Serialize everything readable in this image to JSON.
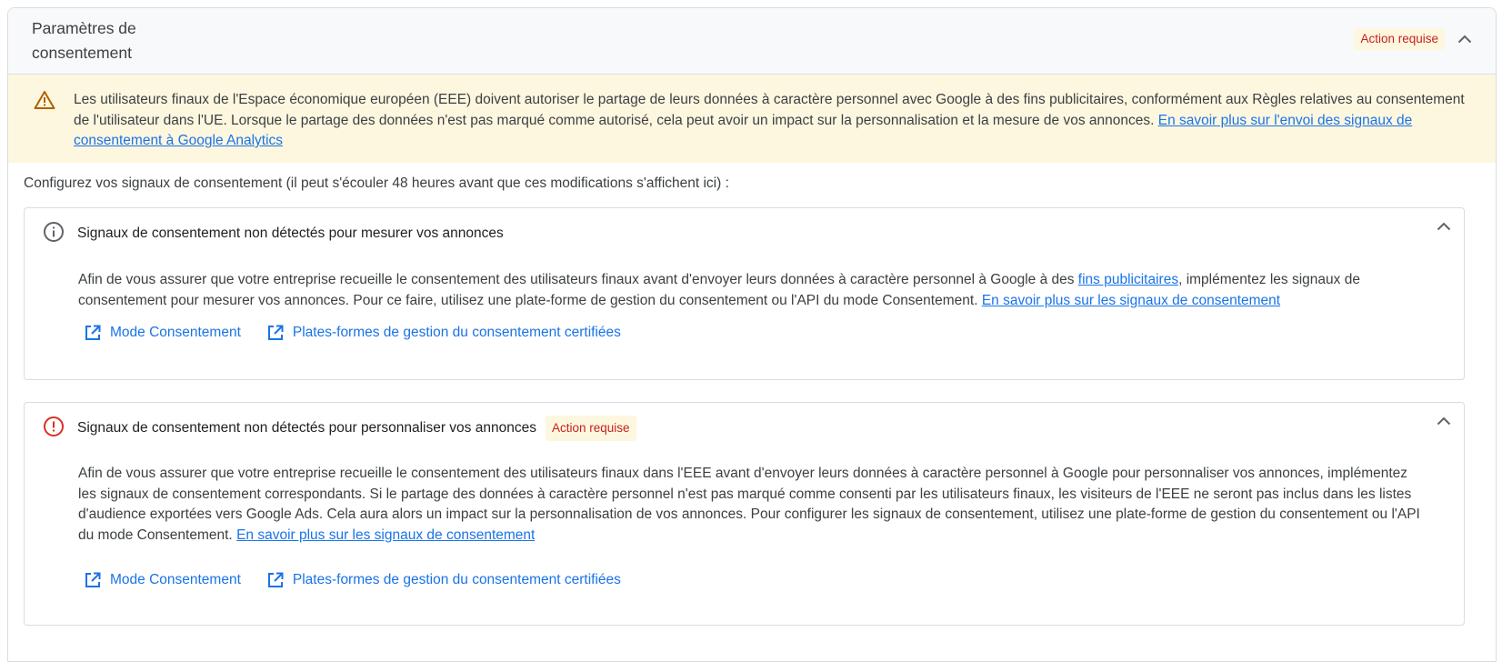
{
  "header": {
    "title": "Paramètres de consentement",
    "badge": "Action requise"
  },
  "warning": {
    "text": "Les utilisateurs finaux de l'Espace économique européen (EEE) doivent autoriser le partage de leurs données à caractère personnel avec Google à des fins publicitaires, conformément aux Règles relatives au consentement de l'utilisateur dans l'UE. Lorsque le partage des données n'est pas marqué comme autorisé, cela peut avoir un impact sur la personnalisation et la mesure de vos annonces. ",
    "link": "En savoir plus sur l'envoi des signaux de consentement à Google Analytics"
  },
  "intro": "Configurez vos signaux de consentement (il peut s'écouler 48 heures avant que ces modifications s'affichent ici) :",
  "cards": [
    {
      "title": "Signaux de consentement non détectés pour mesurer vos annonces",
      "body_part1": "Afin de vous assurer que votre entreprise recueille le consentement des utilisateurs finaux avant d'envoyer leurs données à caractère personnel à Google à des ",
      "inline_link": "fins publicitaires",
      "body_part2": ", implémentez les signaux de consentement pour mesurer vos annonces. Pour ce faire, utilisez une plate-forme de gestion du consentement ou l'API du mode Consentement. ",
      "link": "En savoir plus sur les signaux de consentement",
      "actions": [
        "Mode Consentement",
        "Plates-formes de gestion du consentement certifiées"
      ]
    },
    {
      "title": "Signaux de consentement non détectés pour personnaliser vos annonces",
      "badge": "Action requise",
      "body": "Afin de vous assurer que votre entreprise recueille le consentement des utilisateurs finaux dans l'EEE avant d'envoyer leurs données à caractère personnel à Google pour personnaliser vos annonces, implémentez les signaux de consentement correspondants. Si le partage des données à caractère personnel n'est pas marqué comme consenti par les utilisateurs finaux, les visiteurs de l'EEE ne seront pas inclus dans les listes d'audience exportées vers Google Ads. Cela aura alors un impact sur la personnalisation de vos annonces. Pour configurer les signaux de consentement, utilisez une plate-forme de gestion du consentement ou l'API du mode Consentement. ",
      "link": "En savoir plus sur les signaux de consentement",
      "actions": [
        "Mode Consentement",
        "Plates-formes de gestion du consentement certifiées"
      ]
    }
  ],
  "icons": {
    "warning": "warning-triangle-icon",
    "info": "info-icon",
    "error": "error-icon",
    "external": "open-in-new-icon",
    "collapse": "chevron-up-icon"
  },
  "colors": {
    "accent": "#1a73e8",
    "warning_bg": "#fef7e0",
    "warning_icon": "#b06000",
    "error": "#d93025",
    "badge_text": "#c5221f"
  }
}
